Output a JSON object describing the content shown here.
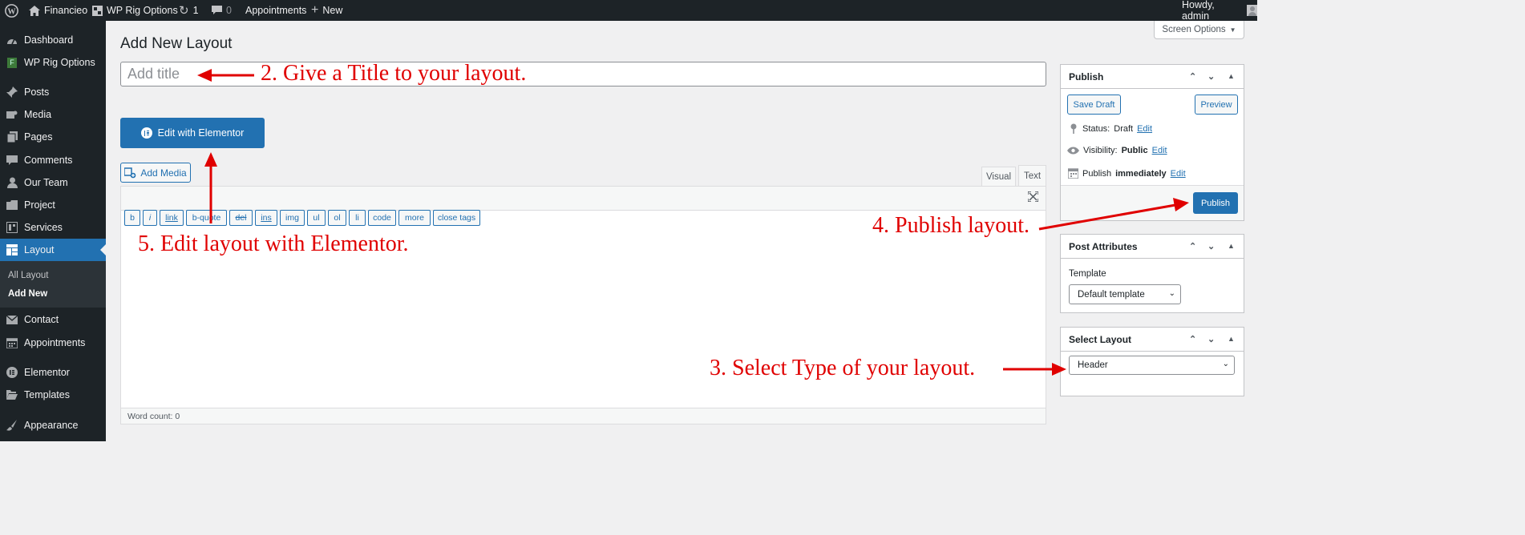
{
  "admin_bar": {
    "site_name": "Financieo",
    "plugin": "WP Rig Options",
    "updates_count": "1",
    "comments_count": "0",
    "appointments": "Appointments",
    "new_label": "New",
    "greeting": "Howdy, admin"
  },
  "sidebar": {
    "items": [
      {
        "label": "Dashboard",
        "icon": "gauge-icon"
      },
      {
        "label": "WP Rig Options",
        "icon": "rig-icon"
      },
      {
        "label": "Posts",
        "icon": "pin-icon"
      },
      {
        "label": "Media",
        "icon": "media-icon"
      },
      {
        "label": "Pages",
        "icon": "pages-icon"
      },
      {
        "label": "Comments",
        "icon": "comment-icon"
      },
      {
        "label": "Our Team",
        "icon": "user-icon"
      },
      {
        "label": "Project",
        "icon": "folder-icon"
      },
      {
        "label": "Services",
        "icon": "services-icon"
      },
      {
        "label": "Layout",
        "icon": "layout-icon"
      },
      {
        "label": "Contact",
        "icon": "mail-icon"
      },
      {
        "label": "Appointments",
        "icon": "calendar-icon"
      },
      {
        "label": "Elementor",
        "icon": "elementor-icon"
      },
      {
        "label": "Templates",
        "icon": "folder-open-icon"
      },
      {
        "label": "Appearance",
        "icon": "brush-icon"
      }
    ],
    "submenu": [
      "All Layout",
      "Add New"
    ]
  },
  "screen_options": "Screen Options",
  "page_title": "Add New Layout",
  "title_placeholder": "Add title",
  "edit_elementor": "Edit with Elementor",
  "add_media": "Add Media",
  "editor_tabs": [
    "Visual",
    "Text"
  ],
  "quicktags": [
    "b",
    "i",
    "link",
    "b-quote",
    "del",
    "ins",
    "img",
    "ul",
    "ol",
    "li",
    "code",
    "more",
    "close tags"
  ],
  "word_count": "Word count: 0",
  "publish_box": {
    "title": "Publish",
    "save_draft": "Save Draft",
    "preview": "Preview",
    "status_label": "Status:",
    "status_value": "Draft",
    "visibility_label": "Visibility:",
    "visibility_value": "Public",
    "publish_when_label": "Publish",
    "publish_when_value": "immediately",
    "edit": "Edit",
    "publish_button": "Publish"
  },
  "attributes_box": {
    "title": "Post Attributes",
    "template_label": "Template",
    "template_value": "Default template"
  },
  "select_layout_box": {
    "title": "Select Layout",
    "value": "Header"
  },
  "annotations": {
    "title": "2. Give a Title to your layout.",
    "select": "3. Select Type of your layout.",
    "publish": "4. Publish layout.",
    "elementor": "5. Edit layout with Elementor."
  },
  "colors": {
    "admin_dark": "#1d2327",
    "accent_blue": "#2271b1",
    "annotation_red": "#e00000",
    "background": "#f0f0f1"
  }
}
